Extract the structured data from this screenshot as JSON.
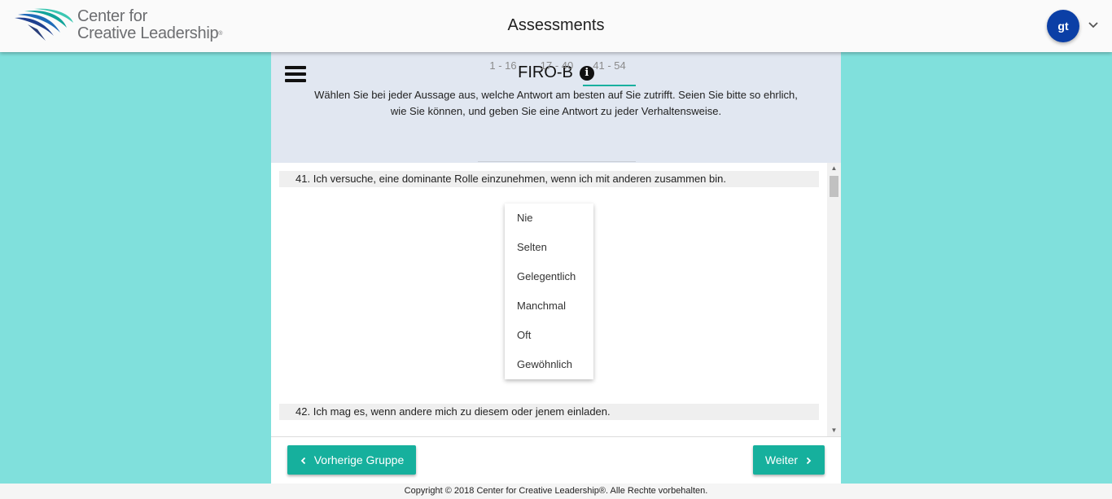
{
  "header": {
    "logo_line1": "Center for",
    "logo_line2": "Creative Leadership",
    "logo_mark": "®",
    "title": "Assessments",
    "avatar_initials": "gt",
    "avatar_menu_icon": "chevron-down-icon"
  },
  "assessment": {
    "title": "FIRO-B",
    "info_icon": "info-icon",
    "info_glyph": "i",
    "menu_icon": "hamburger-icon",
    "instructions": "Wählen Sie bei jeder Aussage aus, welche Antwort am besten auf Sie zutrifft. Seien Sie bitte so ehrlich, wie Sie können, und geben Sie eine Antwort zu jeder Verhaltensweise.",
    "tabs": [
      {
        "label": "1 - 16",
        "active": false
      },
      {
        "label": "17 - 40",
        "active": false
      },
      {
        "label": "41 - 54",
        "active": true
      }
    ]
  },
  "questions": [
    {
      "number": "41.",
      "text": "Ich versuche, eine dominante Rolle einzunehmen, wenn ich mit anderen zusammen bin."
    },
    {
      "number": "42.",
      "text": "Ich mag es, wenn andere mich zu diesem oder jenem einladen."
    }
  ],
  "dropdown_options": [
    "Nie",
    "Selten",
    "Gelegentlich",
    "Manchmal",
    "Oft",
    "Gewöhnlich"
  ],
  "navigation": {
    "prev_label": "Vorherige Gruppe",
    "next_label": "Weiter",
    "prev_icon": "chevron-left-icon",
    "next_icon": "chevron-right-icon"
  },
  "footer": {
    "copyright": "Copyright © 2018 Center for Creative Leadership®. Alle Rechte vorbehalten."
  },
  "colors": {
    "accent": "#16b09d",
    "background_teal": "#80e0dc",
    "header_panel": "#e1e7f1",
    "avatar": "#0b3fa6"
  }
}
